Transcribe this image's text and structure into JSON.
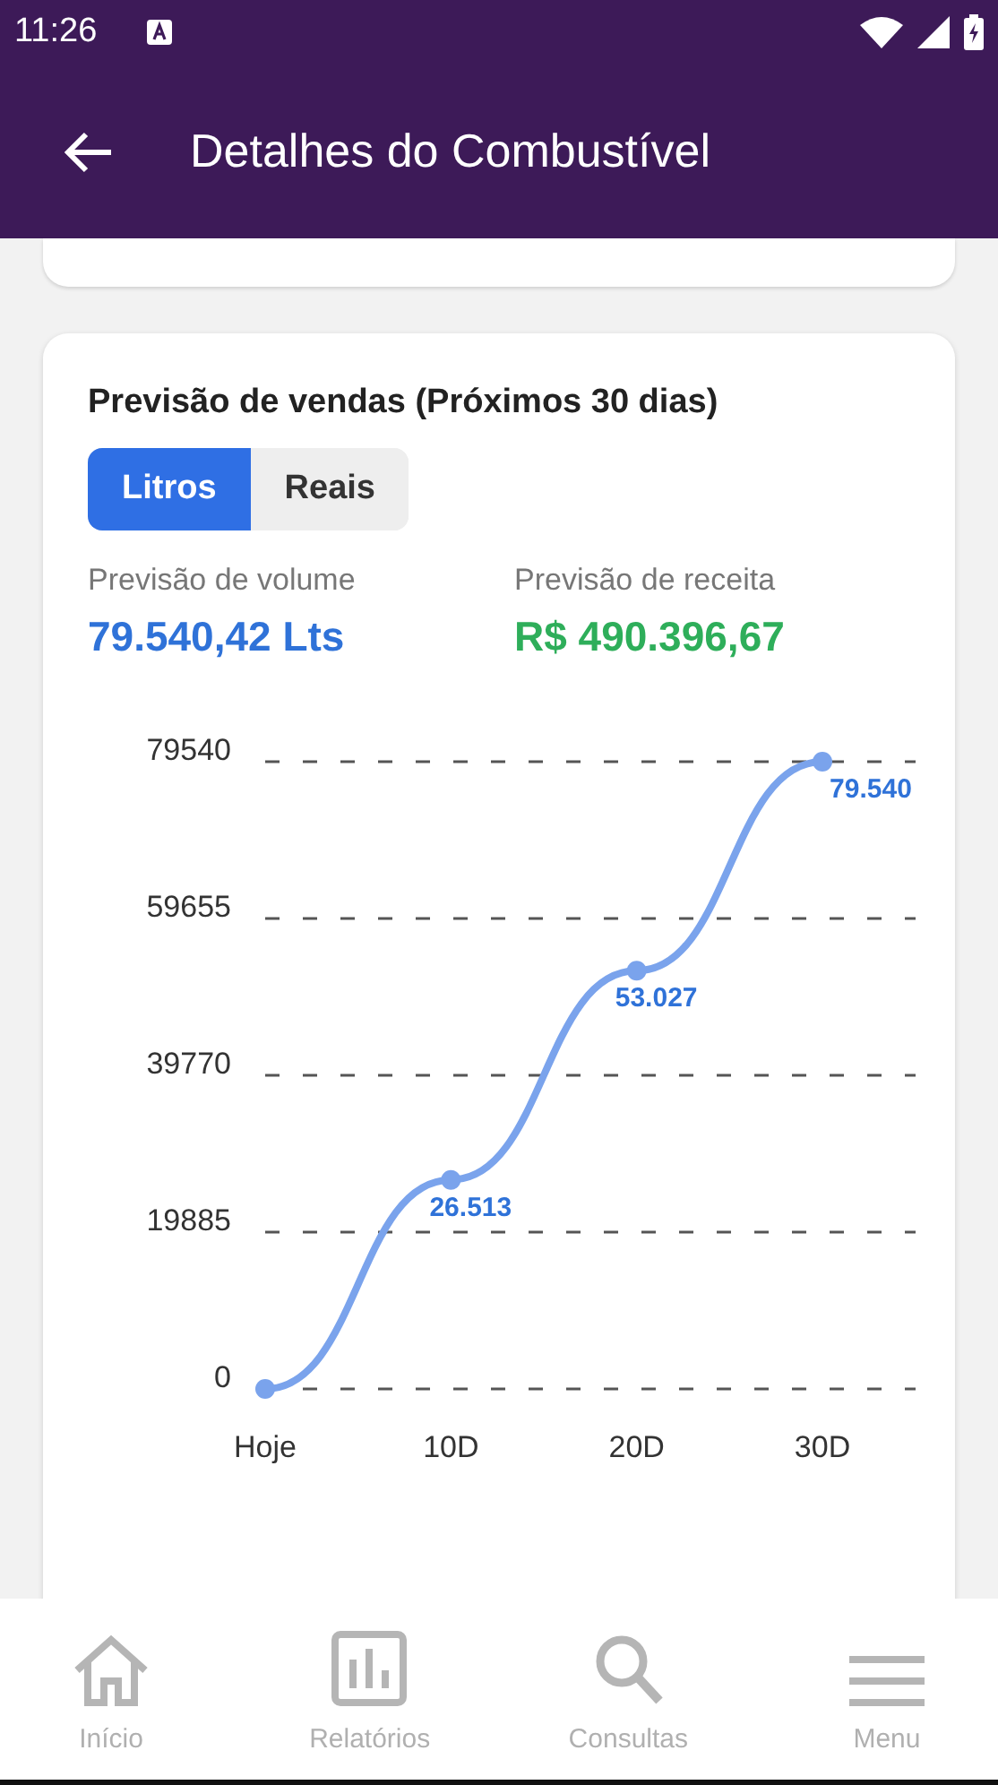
{
  "status_bar": {
    "time": "11:26"
  },
  "app_bar": {
    "title": "Detalhes do Combustível"
  },
  "forecast_card": {
    "title": "Previsão de vendas (Próximos 30 dias)",
    "toggle": [
      {
        "label": "Litros",
        "selected": true
      },
      {
        "label": "Reais",
        "selected": false
      }
    ],
    "metrics": [
      {
        "label": "Previsão de volume",
        "value": "79.540,42 Lts",
        "color": "#2f72d8"
      },
      {
        "label": "Previsão de receita",
        "value": "R$ 490.396,67",
        "color": "#2eae5a"
      }
    ],
    "chart_data": {
      "type": "line",
      "categories": [
        "Hoje",
        "10D",
        "20D",
        "30D"
      ],
      "series": [
        {
          "color": "#7aa3ec",
          "marker": true,
          "values": [
            0,
            26513,
            53027,
            79540
          ]
        }
      ],
      "grid": true,
      "ylim": [
        0,
        79540
      ],
      "yticks": [
        0,
        19885,
        39770,
        59655,
        79540
      ],
      "value_labels": [
        null,
        "26.513",
        "53.027",
        "79.540"
      ]
    }
  },
  "bottom_nav": [
    {
      "label": "Início",
      "kind": "home"
    },
    {
      "label": "Relatórios",
      "kind": "reports"
    },
    {
      "label": "Consultas",
      "kind": "search"
    },
    {
      "label": "Menu",
      "kind": "menu"
    }
  ]
}
